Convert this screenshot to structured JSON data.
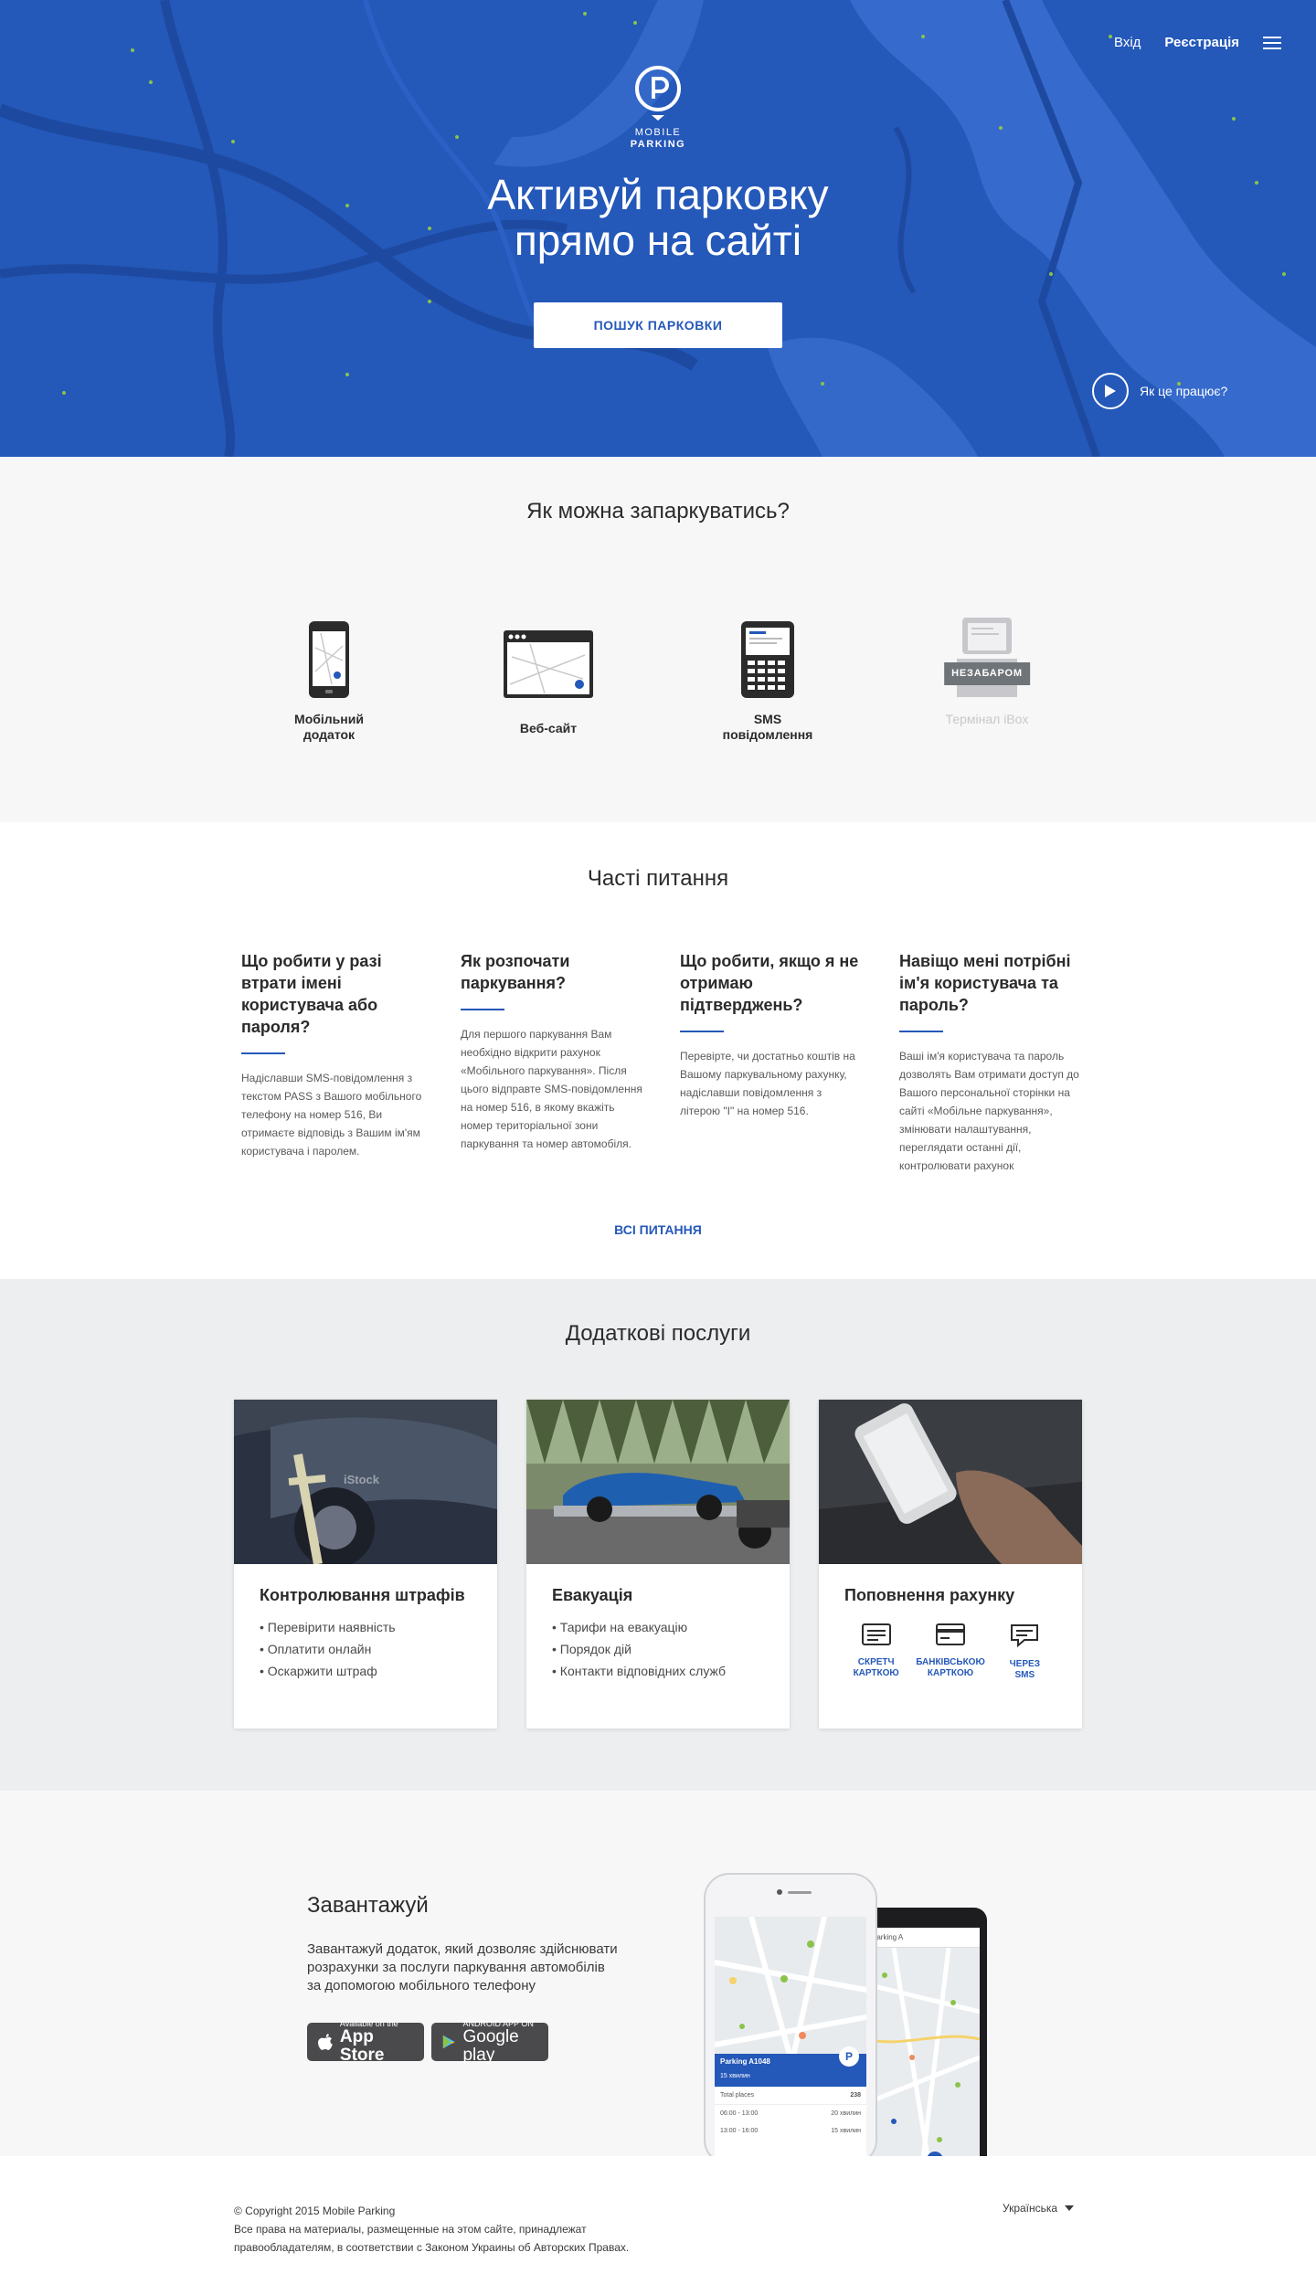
{
  "header": {
    "login": "Вхід",
    "register": "Реєстрація"
  },
  "hero": {
    "logo_line1": "MOBILE",
    "logo_line2": "PARKING",
    "title_line1": "Активуй парковку",
    "title_line2": "прямо на сайті",
    "search_button": "ПОШУК ПАРКОВКИ",
    "how_it_works": "Як це працює?"
  },
  "ways": {
    "title": "Як можна запаркуватись?",
    "items": [
      {
        "label_line1": "Мобільний",
        "label_line2": "додаток"
      },
      {
        "label_line1": "Веб-сайт",
        "label_line2": ""
      },
      {
        "label_line1": "SMS",
        "label_line2": "повідомлення"
      },
      {
        "label_line1": "Термінал iBox",
        "label_line2": "",
        "badge": "НЕЗАБАРОМ"
      }
    ]
  },
  "faq": {
    "title": "Часті питання",
    "items": [
      {
        "question": "Що робити у разі втрати імені користувача або пароля?",
        "answer": "Надіславши SMS-повідомлення з текстом PASS з Вашого мобільного телефону на номер 516, Ви отримаєте відповідь з Вашим ім'ям користувача і паролем."
      },
      {
        "question": "Як розпочати паркування?",
        "answer": "Для першого паркування Вам необхідно відкрити рахунок «Мобільного паркування». Після цього відправте SMS-повідомлення на номер 516, в якому вкажіть номер територіальної зони паркування та номер автомобіля."
      },
      {
        "question": "Що робити, якщо я не отримаю підтверджень?",
        "answer": "Перевірте, чи достатньо коштів на Вашому паркувальному рахунку, надіславши повідомлення з літерою \"I\" на номер 516."
      },
      {
        "question": "Навіщо мені потрібні ім'я користувача та пароль?",
        "answer": "Ваші ім'я користувача та пароль дозволять Вам отримати доступ до Вашого персональної сторінки на сайті «Мобільне паркування», змінювати налаштування, переглядати останні дії, контролювати рахунок"
      }
    ],
    "all_link": "ВСІ ПИТАННЯ"
  },
  "extra": {
    "title": "Додаткові послуги",
    "cards": [
      {
        "title": "Контролювання штрафів",
        "items": [
          "Перевірити наявність",
          "Оплатити онлайн",
          "Оскаржити штраф"
        ]
      },
      {
        "title": "Евакуація",
        "items": [
          "Тарифи на евакуацію",
          "Порядок дій",
          "Контакти відповідних служб"
        ]
      },
      {
        "title": "Поповнення рахунку",
        "options": [
          {
            "line1": "СКРЕТЧ",
            "line2": "КАРТКОЮ",
            "icon": "scratch-card-icon"
          },
          {
            "line1": "БАНКІВСЬКОЮ",
            "line2": "КАРТКОЮ",
            "icon": "bank-card-icon"
          },
          {
            "line1": "ЧЕРЕЗ",
            "line2": "SMS",
            "icon": "sms-icon"
          }
        ]
      }
    ],
    "watermark": "iStock"
  },
  "download": {
    "title": "Завантажуй",
    "text": "Завантажуй додаток, який дозволяє здійснювати розрахунки за послуги паркування автомобілів за допомогою мобільного телефону",
    "appstore_small": "Available on the",
    "appstore_big": "App Store",
    "googleplay_small": "ANDROID APP ON",
    "googleplay_big": "Google play",
    "phone_parking": "Parking A1048",
    "phone_minutes": "15 хвилин",
    "phone_total_label": "Total places",
    "phone_total_value": "238",
    "phone_row1_time": "06:00 - 13:00",
    "phone_row1_value": "20 хвилин",
    "phone_row2_time": "13:00 - 16:00",
    "phone_row2_value": "15 хвилин",
    "phone_search": "Parking A"
  },
  "footer": {
    "copyright": "© Copyright 2015 Mobile Parking",
    "rights_line1": "Все права на материалы, размещенные на этом сайте, принадлежат",
    "rights_line2": "правообладателям, в соответствии с Законом Украины об Авторских Правах.",
    "language": "Українська"
  },
  "colors": {
    "brand_blue": "#2458b9",
    "accent_green": "#8bc34a"
  }
}
